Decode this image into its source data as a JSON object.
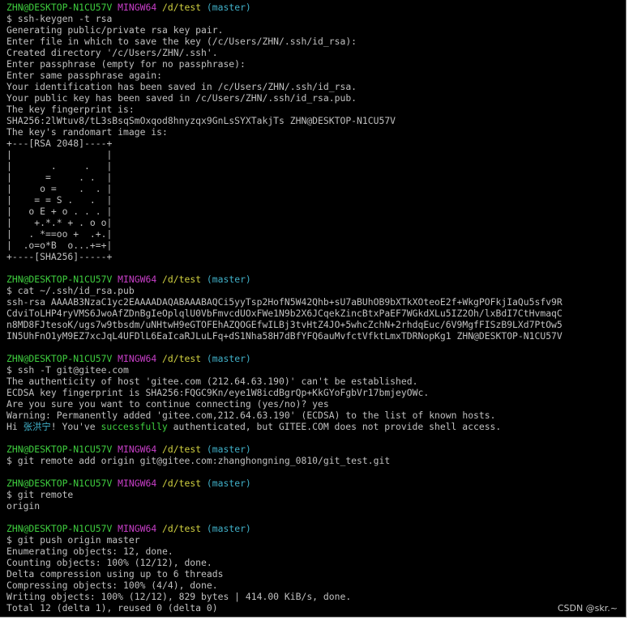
{
  "prompt": {
    "user": "ZHN@DESKTOP-N1CU57V",
    "shell": "MINGW64",
    "path": "/d/test",
    "branch": "(master)"
  },
  "blocks": [
    {
      "command": "$ ssh-keygen -t rsa",
      "output": [
        "Generating public/private rsa key pair.",
        "Enter file in which to save the key (/c/Users/ZHN/.ssh/id_rsa):",
        "Created directory '/c/Users/ZHN/.ssh'.",
        "Enter passphrase (empty for no passphrase):",
        "Enter same passphrase again:",
        "Your identification has been saved in /c/Users/ZHN/.ssh/id_rsa.",
        "Your public key has been saved in /c/Users/ZHN/.ssh/id_rsa.pub.",
        "The key fingerprint is:",
        "SHA256:2lWtuv8/tL3sBsqSmOxqod8hnyzqx9GnLsSYXTakjTs ZHN@DESKTOP-N1CU57V",
        "The key's randomart image is:",
        "+---[RSA 2048]----+",
        "|                 |",
        "|       .     .   |",
        "|      =     . .  |",
        "|     o =    .  . |",
        "|    = = S .   .  |",
        "|   o E + o . . . |",
        "|    +.*.* + . o o|",
        "|   . *==oo +  .+.|",
        "|  .o=o*B  o...+=+|",
        "+----[SHA256]-----+"
      ]
    },
    {
      "command": "$ cat ~/.ssh/id_rsa.pub",
      "output": [
        "ssh-rsa AAAAB3NzaC1yc2EAAAADAQABAAABAQCi5yyTsp2HofN5W42Qhb+sU7aBUhOB9bXTkXOteoE2f+WkgPOFkjIaQu5sfv9R",
        "CdviToLHP4ryVMS6JwoAfZDnBgIeOplqlU0VbFmvcdUOxFWe1N9b2X6JCqekZincBtxPaEF7WGkdXLu5IZ2Oh/lxBdI7CtHvmaqC",
        "n8MD8FJtesoK/ugs7w9tbsdm/uNHtwH9eGTOFEhAZQOGEfwILBj3tvHtZ4JO+5whcZchN+2rhdqEuc/6V9MgfFISzB9LXd7PtOw5",
        "IN5UhFnO1yM9EZ7xcJqL4UFDlL6EaIcaRJLuLFq+dS1Nha58H7dBfYFQ6auMvfctVfktLmxTDRNopKg1 ZHN@DESKTOP-N1CU57V"
      ]
    },
    {
      "command": "$ ssh -T git@gitee.com",
      "output": [
        "The authenticity of host 'gitee.com (212.64.63.190)' can't be established.",
        "ECDSA key fingerprint is SHA256:FQGC9Kn/eye1W8icdBgrQp+KkGYoFgbVr17bmjeyOWc.",
        "Are you sure you want to continue connecting (yes/no)? yes",
        "Warning: Permanently added 'gitee.com,212.64.63.190' (ECDSA) to the list of known hosts."
      ],
      "hi_line": {
        "prefix": "Hi ",
        "name": "张洪宁",
        "mid": "! You've ",
        "success": "successfully",
        "suffix": " authenticated, but GITEE.COM does not provide shell access."
      }
    },
    {
      "command": "$ git remote add origin git@gitee.com:zhanghongning_0810/git_test.git",
      "output": []
    },
    {
      "command": "$ git remote",
      "output": [
        "origin"
      ]
    },
    {
      "command": "$ git push origin master",
      "output": [
        "Enumerating objects: 12, done.",
        "Counting objects: 100% (12/12), done.",
        "Delta compression using up to 6 threads",
        "Compressing objects: 100% (4/4), done.",
        "Writing objects: 100% (12/12), 829 bytes | 414.00 KiB/s, done.",
        "Total 12 (delta 1), reused 0 (delta 0)"
      ]
    }
  ],
  "left_clip": {
    "c_char": "C",
    "g_char": "g"
  },
  "watermark": "CSDN @skr.~",
  "colors": {
    "user": "#3fcf3f",
    "shell": "#c93fc9",
    "path": "#d0d040",
    "branch": "#40b0c8",
    "text": "#c0c0c0",
    "background": "#000000"
  }
}
